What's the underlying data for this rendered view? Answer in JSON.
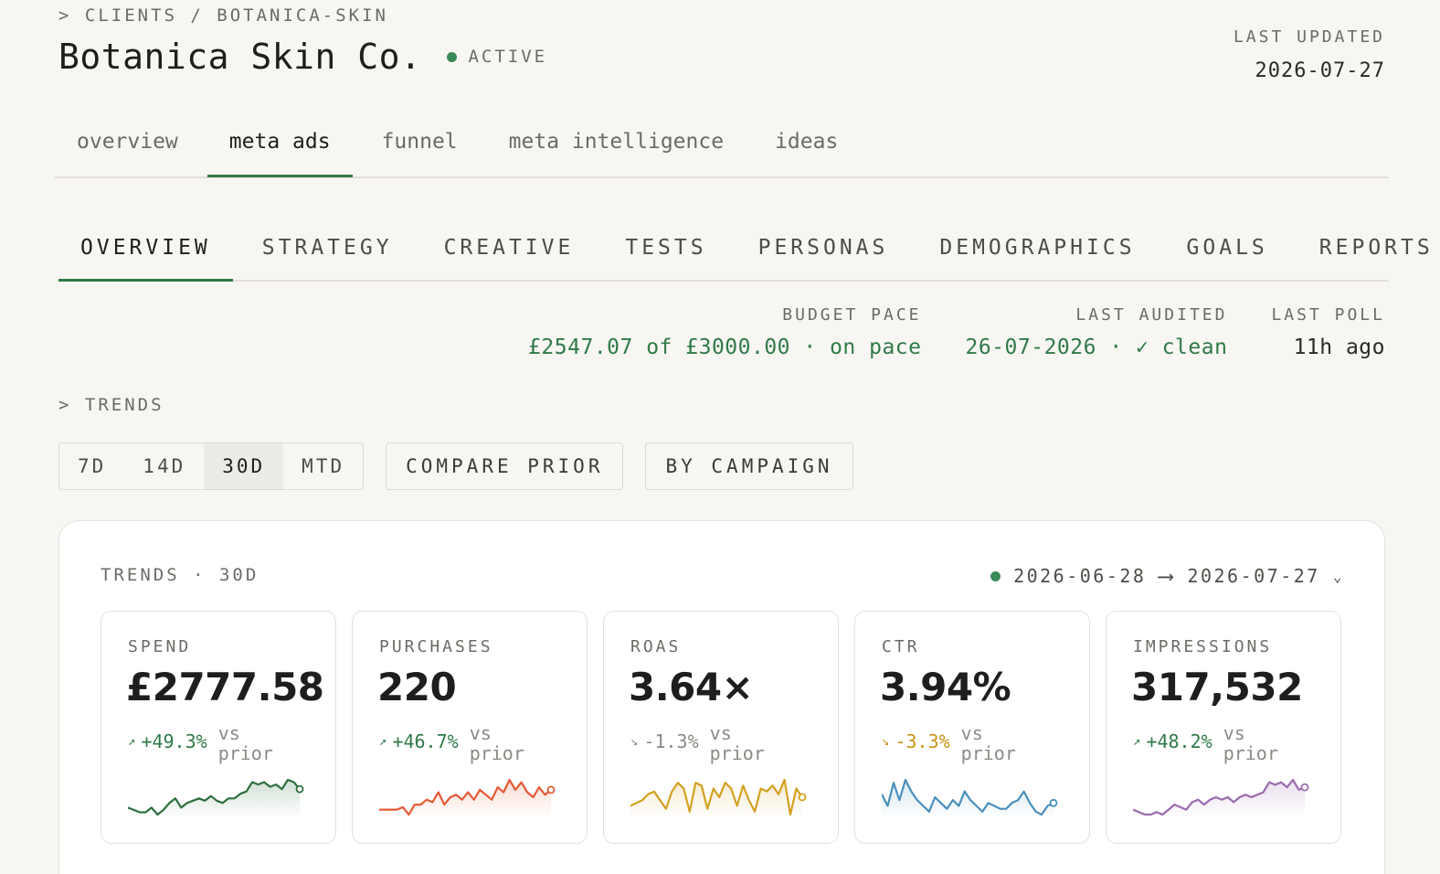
{
  "breadcrumb": "> CLIENTS / BOTANICA-SKIN",
  "page_title": "Botanica Skin Co.",
  "status": "ACTIVE",
  "last_updated": {
    "label": "LAST UPDATED",
    "value": "2026-07-27"
  },
  "tabs": [
    {
      "label": "overview"
    },
    {
      "label": "meta ads",
      "active": true
    },
    {
      "label": "funnel"
    },
    {
      "label": "meta intelligence"
    },
    {
      "label": "ideas"
    }
  ],
  "subtabs": [
    {
      "label": "OVERVIEW",
      "active": true
    },
    {
      "label": "STRATEGY"
    },
    {
      "label": "CREATIVE"
    },
    {
      "label": "TESTS"
    },
    {
      "label": "PERSONAS"
    },
    {
      "label": "DEMOGRAPHICS"
    },
    {
      "label": "GOALS"
    },
    {
      "label": "REPORTS"
    }
  ],
  "stats": {
    "budget_pace": {
      "label": "BUDGET PACE",
      "value": "£2547.07 of £3000.00 · on pace"
    },
    "last_audited": {
      "label": "LAST AUDITED",
      "value": "26-07-2026 · ✓ clean"
    },
    "last_poll": {
      "label": "LAST POLL",
      "value": "11h ago"
    }
  },
  "section_label": "> TRENDS",
  "ranges": [
    "7D",
    "14D",
    "30D",
    "MTD"
  ],
  "active_range": "30D",
  "compare_label": "COMPARE PRIOR",
  "by_campaign_label": "BY CAMPAIGN",
  "panel": {
    "title": "TRENDS · 30D",
    "date_from": "2026-06-28",
    "arrow": "⟶",
    "date_to": "2026-07-27"
  },
  "vs_label": "vs prior",
  "colors": {
    "accent": "#2f7a48",
    "status_dot": "#3a8a58"
  },
  "cards": [
    {
      "label": "SPEND",
      "value": "£2777.58",
      "delta": "+49.3%",
      "trend": "up",
      "trend_icon": "trending-up-icon",
      "color": "#2e6f3e",
      "series": [
        3,
        2,
        1,
        1,
        3,
        0,
        2,
        5,
        7,
        3,
        5,
        6,
        7,
        6,
        8,
        6,
        5,
        7,
        7,
        9,
        10,
        14,
        13,
        14,
        12,
        13,
        11,
        15,
        14,
        11
      ]
    },
    {
      "label": "PURCHASES",
      "value": "220",
      "delta": "+46.7%",
      "trend": "up",
      "trend_icon": "trending-up-icon",
      "color": "#e45a35",
      "series": [
        4,
        4,
        4,
        4,
        5,
        2,
        6,
        6,
        8,
        7,
        11,
        6,
        9,
        10,
        8,
        11,
        8,
        12,
        10,
        8,
        13,
        11,
        16,
        12,
        15,
        11,
        9,
        13,
        10,
        12
      ]
    },
    {
      "label": "ROAS",
      "value": "3.64×",
      "delta": "-1.3%",
      "trend": "flat",
      "trend_icon": "trending-flat-down-icon",
      "color": "#d4a020",
      "series": [
        7,
        8,
        9,
        11,
        12,
        9,
        6,
        12,
        15,
        13,
        5,
        15,
        14,
        6,
        13,
        10,
        15,
        13,
        7,
        14,
        9,
        5,
        13,
        12,
        14,
        11,
        16,
        4,
        13,
        10
      ]
    },
    {
      "label": "CTR",
      "value": "3.94%",
      "delta": "-3.3%",
      "trend": "down",
      "trend_icon": "trending-down-icon",
      "color": "#4a8fbd",
      "series": [
        11,
        7,
        15,
        9,
        16,
        12,
        9,
        7,
        5,
        10,
        8,
        6,
        9,
        7,
        12,
        9,
        7,
        5,
        8,
        7,
        6,
        6,
        8,
        9,
        12,
        8,
        5,
        4,
        7,
        8
      ]
    },
    {
      "label": "IMPRESSIONS",
      "value": "317,532",
      "delta": "+48.2%",
      "trend": "up",
      "trend_icon": "trending-up-icon",
      "color": "#9a6bb0",
      "series": [
        3,
        2,
        1,
        1,
        2,
        1,
        3,
        5,
        4,
        3,
        6,
        7,
        5,
        7,
        8,
        7,
        8,
        6,
        8,
        9,
        8,
        9,
        10,
        14,
        13,
        14,
        12,
        15,
        11,
        12
      ]
    }
  ]
}
